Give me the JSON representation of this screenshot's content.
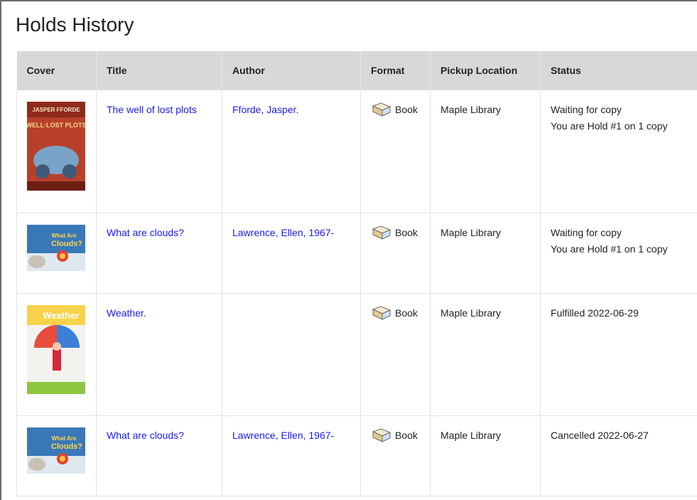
{
  "page": {
    "title": "Holds History"
  },
  "table": {
    "headers": [
      "Cover",
      "Title",
      "Author",
      "Format",
      "Pickup Location",
      "Status"
    ],
    "rows": [
      {
        "cover": {
          "text": "JASPER FFORDE",
          "text2": "WELL·LOST PLOTS",
          "bg": "#b8402a"
        },
        "title": "The well of lost plots",
        "author": "Fforde, Jasper.",
        "format": "Book",
        "pickup": "Maple Library",
        "status": [
          "Waiting for copy",
          "You are Hold #1 on 1 copy"
        ]
      },
      {
        "cover": {
          "text": "What Are",
          "text2": "Clouds?",
          "bg": "#3a78b8"
        },
        "title": "What are clouds?",
        "author": "Lawrence, Ellen, 1967-",
        "format": "Book",
        "pickup": "Maple Library",
        "status": [
          "Waiting for copy",
          "You are Hold #1 on 1 copy"
        ]
      },
      {
        "cover": {
          "text": "Weather",
          "text2": "",
          "bg": "#f2f2ee"
        },
        "title": "Weather.",
        "author": "",
        "format": "Book",
        "pickup": "Maple Library",
        "status": [
          "Fulfilled 2022-06-29"
        ]
      },
      {
        "cover": {
          "text": "What Are",
          "text2": "Clouds?",
          "bg": "#3a78b8"
        },
        "title": "What are clouds?",
        "author": "Lawrence, Ellen, 1967-",
        "format": "Book",
        "pickup": "Maple Library",
        "status": [
          "Cancelled 2022-06-27"
        ]
      }
    ]
  },
  "icons": {
    "format": "book-icon"
  },
  "colors": {
    "link": "#1a1aee",
    "header_bg": "#d8d8d8"
  }
}
